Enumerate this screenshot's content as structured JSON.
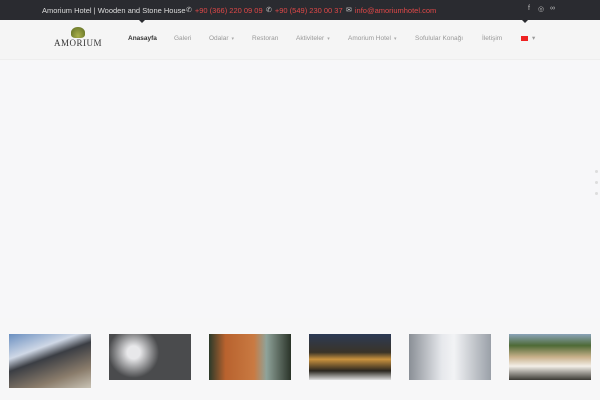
{
  "topbar": {
    "title": "Amorium Hotel | Wooden and Stone House",
    "phone1": "+90 (366) 220 09 09",
    "phone2": "+90 (549) 230 00 37",
    "email": "info@amoriumhotel.com",
    "social": [
      "facebook-icon",
      "instagram-icon",
      "tripadvisor-icon"
    ]
  },
  "logo": {
    "text": "AMORIUM"
  },
  "menu": [
    {
      "label": "Anasayfa"
    },
    {
      "label": "Galeri"
    },
    {
      "label": "Odalar"
    },
    {
      "label": "Restoran"
    },
    {
      "label": "Aktiviteler"
    },
    {
      "label": "Amorium Hotel"
    },
    {
      "label": "Sofulular Konağı"
    },
    {
      "label": "İletişim"
    }
  ],
  "colors": {
    "accent": "#e04848",
    "topbar": "#2a2b30"
  }
}
